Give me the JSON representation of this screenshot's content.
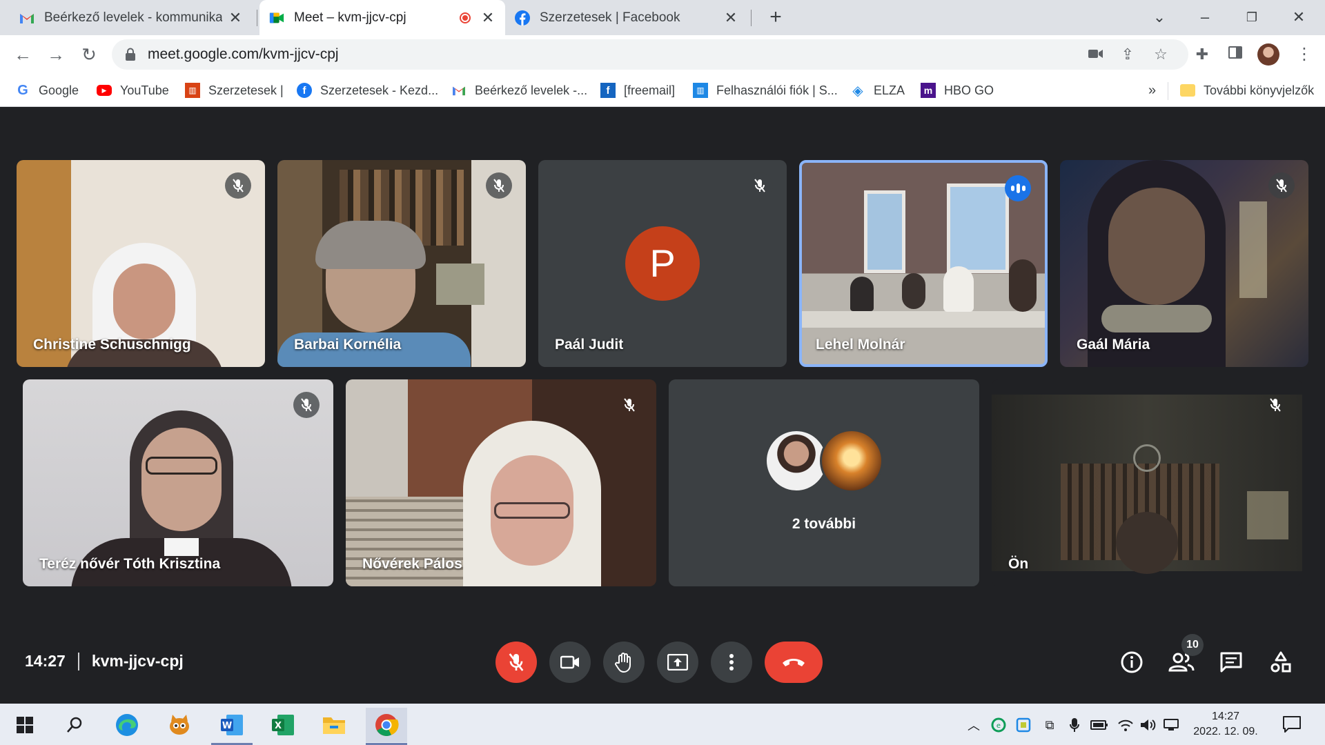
{
  "browser": {
    "tabs": [
      {
        "title": "Beérkező levelek - kommunikació",
        "icon": "gmail-icon"
      },
      {
        "title": "Meet – kvm-jjcv-cpj",
        "icon": "meet-icon",
        "recording": true
      },
      {
        "title": "Szerzetesek | Facebook",
        "icon": "facebook-icon"
      }
    ],
    "url": "meet.google.com/kvm-jjcv-cpj"
  },
  "bookmarks": [
    {
      "label": "Google",
      "icon": "google-icon"
    },
    {
      "label": "YouTube",
      "icon": "youtube-icon"
    },
    {
      "label": "Szerzetesek |",
      "icon": "szerzetesek-icon"
    },
    {
      "label": "Szerzetesek - Kezd...",
      "icon": "facebook-icon"
    },
    {
      "label": "Beérkező levelek -...",
      "icon": "gmail-icon"
    },
    {
      "label": "[freemail]",
      "icon": "freemail-icon"
    },
    {
      "label": "Felhasználói fiók | S...",
      "icon": "szerzetesek-icon"
    },
    {
      "label": "ELZA",
      "icon": "elza-icon"
    },
    {
      "label": "HBO GO",
      "icon": "hbo-icon"
    }
  ],
  "bookmarks_overflow": "»",
  "other_bookmarks": "További könyvjelzők",
  "meet": {
    "participants": [
      {
        "name": "Christine Schuschnigg",
        "muted": true
      },
      {
        "name": "Barbai Kornélia",
        "muted": true
      },
      {
        "name": "Paál Judit",
        "muted": true,
        "avatar_letter": "P"
      },
      {
        "name": "Lehel Molnár",
        "muted": false,
        "speaking": true
      },
      {
        "name": "Gaál Mária",
        "muted": true
      },
      {
        "name": "Teréz nővér Tóth Krisztina",
        "muted": true
      },
      {
        "name": "Nővérek Pálos",
        "muted": true
      },
      {
        "name": "Ön",
        "muted": true
      }
    ],
    "more_label": "2 további",
    "time": "14:27",
    "meeting_code": "kvm-jjcv-cpj",
    "participant_count": "10"
  },
  "taskbar": {
    "time": "14:27",
    "date": "2022. 12. 09."
  }
}
